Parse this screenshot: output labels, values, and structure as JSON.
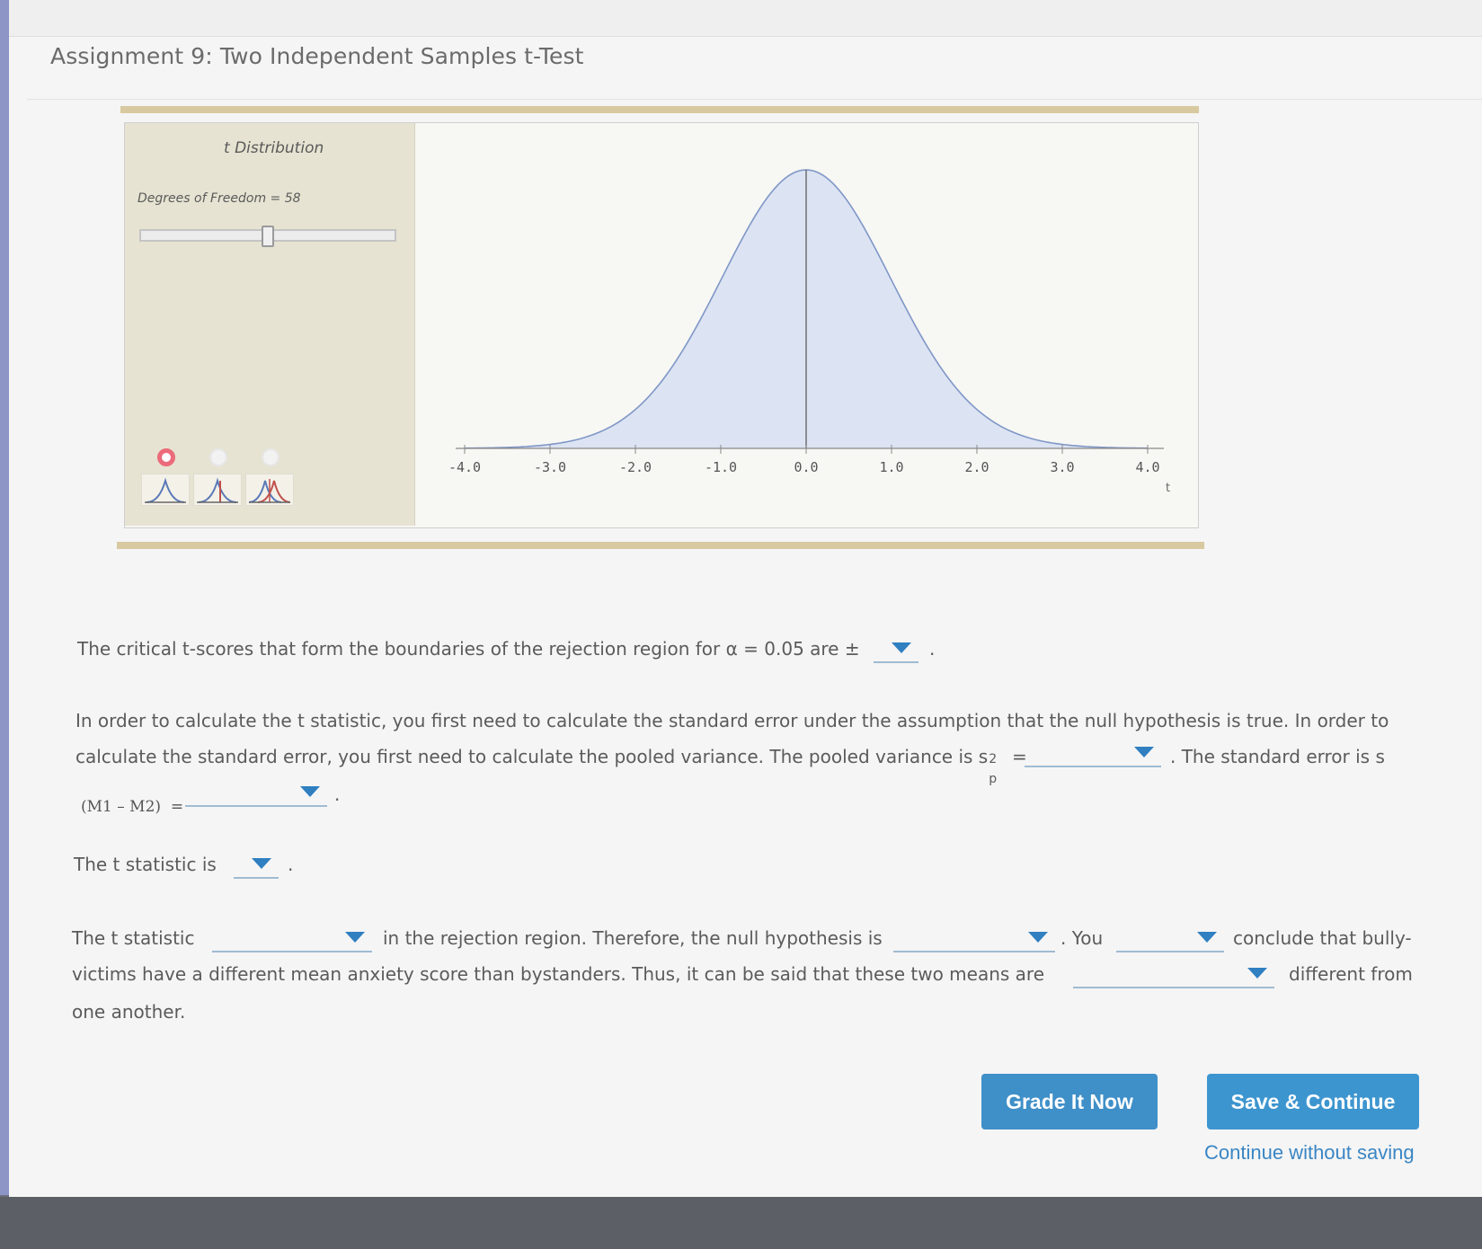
{
  "page": {
    "title": "Assignment 9: Two Independent Samples t-Test"
  },
  "widget": {
    "panel_title": "t Distribution",
    "df_label": "Degrees of Freedom = 58",
    "df_slider_level": 0.5,
    "distribution_options": [
      {
        "selected": true,
        "icon": "single-curve-icon"
      },
      {
        "selected": false,
        "icon": "two-tail-curve-icon"
      },
      {
        "selected": false,
        "icon": "multi-curve-icon"
      }
    ]
  },
  "chart_data": {
    "type": "area",
    "title": "",
    "xlabel": "t",
    "ylabel": "",
    "xlim": [
      -4.0,
      4.0
    ],
    "x_ticks": [
      "-4.0",
      "-3.0",
      "-2.0",
      "-1.0",
      "0.0",
      "1.0",
      "2.0",
      "3.0",
      "4.0"
    ],
    "series": [
      {
        "distribution": "t",
        "df": 58,
        "fill": "#dce3f3",
        "line": "#7f97c6"
      }
    ],
    "marker_line_x": 0.0,
    "grid": false
  },
  "questions": {
    "q1_text": "The critical t-scores that form the boundaries of the rejection region for α = 0.05 are ±",
    "q1_end": ".",
    "q2_line1": "In order to calculate the t statistic, you first need to calculate the standard error under the assumption that the null hypothesis is true. In order to",
    "q2_line2": "calculate the standard error, you first need to calculate the pooled variance. The pooled variance is s",
    "q2_sup": "2",
    "q2_sub": "p",
    "q2_equals": "=",
    "q2_after": ". The standard error is s",
    "q2_formula": "(M1 – M2)",
    "q2_formula_equals": "=",
    "q2_end": ".",
    "q3_text": "The t statistic is",
    "q3_end": ".",
    "q4_part1": "The t statistic",
    "q4_part2": "in the rejection region. Therefore, the null hypothesis is",
    "q4_part3": ". You",
    "q4_part4": "conclude that bully-",
    "q4_line2a": "victims have a different mean anxiety score than bystanders. Thus, it can be said that these two means are",
    "q4_line2b": "different from",
    "q4_line3": "one another."
  },
  "buttons": {
    "grade": "Grade It Now",
    "save": "Save & Continue",
    "continue_link": "Continue without saving"
  }
}
